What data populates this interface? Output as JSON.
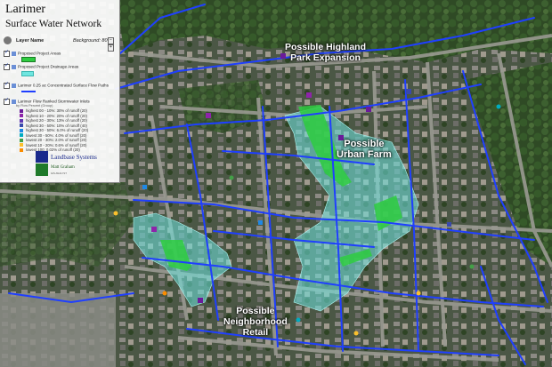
{
  "title": {
    "line1": "Larimer",
    "line2": "Surface Water Network"
  },
  "layer_panel": {
    "header_label": "Layer Name",
    "background_label": "Background: 80%",
    "btn_minus": "−",
    "btn_plus": "+",
    "layers": [
      {
        "name": "Proposed Project Areas"
      },
      {
        "name": "Proposed Project Drainage Areas"
      },
      {
        "name": "Larimer 0.25 ac Concentrated Surface Flow Paths"
      },
      {
        "name": "Larimer Flow Ranked Stormwater Inlets",
        "sub": "by Flow Percent (Group)"
      }
    ],
    "inlet_classes": [
      {
        "label": "highest 00 - 10%: 30% of runoff (20)",
        "color": "#6a1b9a"
      },
      {
        "label": "highest 10 - 20%: 20% of runoff (20)",
        "color": "#8e24aa"
      },
      {
        "label": "highest 20 - 30%: 13% of runoff (20)",
        "color": "#5e35b1"
      },
      {
        "label": "highest 30 - 50%: 10% of runoff (40)",
        "color": "#3949ab"
      },
      {
        "label": "highest 30 - 50%: 6.0% of runoff (20)",
        "color": "#1e88e5"
      },
      {
        "label": "lowest 30 - 50%: 4.0% of runoff (20)",
        "color": "#00acc1"
      },
      {
        "label": "lowest 20 - 30%: 2.0% of runoff (20)",
        "color": "#43a047"
      },
      {
        "label": "lowest 10 - 20%: 0.6% of runoff (20)",
        "color": "#fbc02d"
      },
      {
        "label": "lowest 100: 0.02% of runoff (20)",
        "color": "#fb8c00"
      }
    ]
  },
  "branding": {
    "company": "Landbase Systems",
    "person": "Matt Graham",
    "detail": "GIS ANALYST"
  },
  "map_labels": {
    "highland": "Possible Highland\nPark Expansion",
    "urban_farm": "Possible\nUrban Farm",
    "retail": "Possible\nNeighborhood\nRetail"
  },
  "colors": {
    "flow_paths": "#1f3fff",
    "drainage_areas": "#6fe6e0",
    "project_areas": "#2ecc40",
    "vegetation": "#3f5d2e"
  }
}
